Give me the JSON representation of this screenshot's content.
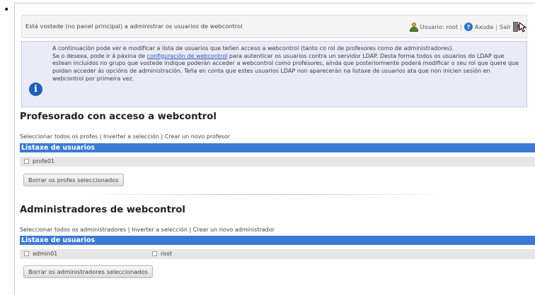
{
  "header": {
    "status_text": "Está vostede (no panel principal) a administrar os usuarios de webcontrol",
    "user_label": "Usuario: root",
    "help_label": "Axuda",
    "exit_label": "Saír",
    "sep": "|"
  },
  "info": {
    "line1": "A continuación pode ver e modificar a lista de usuarios que teñen acceso a webcontrol (tanto co rol de profesores como de administradores).",
    "line2_before": "Se o desexa, pode ir á páxina de ",
    "line2_link": "configuración de webcontrol",
    "line2_after": " para autenticar os usuarios contra un servidor LDAP. Desta forma todos os usuarios do LDAP que estean incluídos no grupo que vostede indique poderán acceder a webcontrol como profesores, aínda que posteriormente poderá modificar o seu rol que quere que poidan acceder ás opcións de administración. Teña en conta que estes usuarios LDAP non aparecerán na listaxe de usuarios ata que non inicien sesión en webcontrol por primeira vez."
  },
  "teachers": {
    "title": "Profesorado con acceso a webcontrol",
    "select_all": "Seleccionar todos os profes",
    "invert": "Inverter a selección",
    "create": "Crear un novo profesor",
    "list_header": "Listaxe de usuarios",
    "users": [
      "profe01"
    ],
    "delete_button": "Borrar os profes seleccionados"
  },
  "admins": {
    "title": "Administradores de webcontrol",
    "select_all": "Seleccionar todos os administradores",
    "invert": "Inverter a selección",
    "create": "Crear un novo administrador",
    "list_header": "Listaxe de usuarios",
    "users": [
      "admin01",
      "root"
    ],
    "delete_button": "Borrar os administradores seleccionados"
  },
  "bullet": "•"
}
